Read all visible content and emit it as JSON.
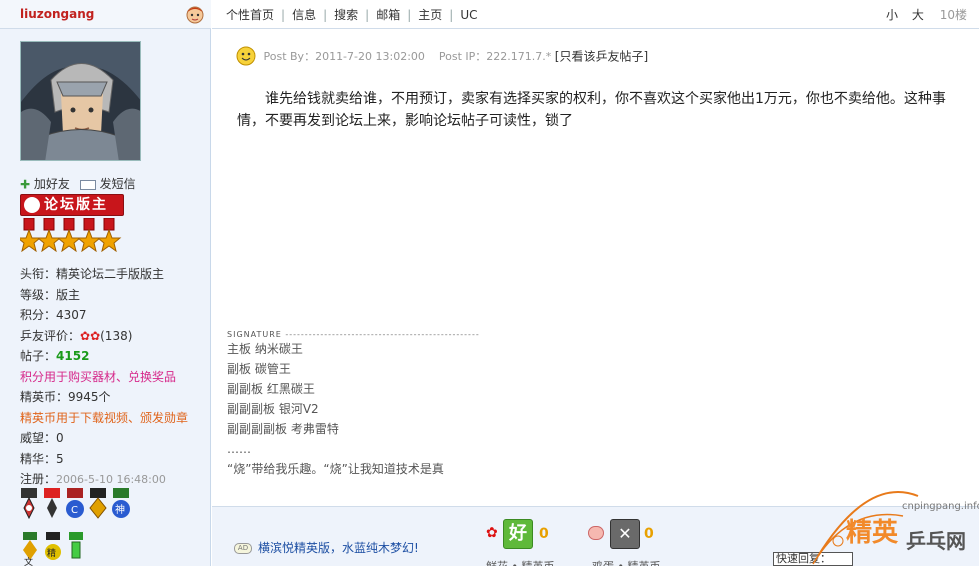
{
  "user": {
    "name": "liuzongang",
    "add_friend": "加好友",
    "send_message": "发短信",
    "badge": "论坛版主",
    "stats": [
      {
        "label": "头衔：",
        "value": "精英论坛二手版版主",
        "style": "normal"
      },
      {
        "label": "等级：",
        "value": "版主",
        "style": "normal"
      },
      {
        "label": "积分：",
        "value": "4307",
        "style": "normal"
      },
      {
        "label": "乒友评价：",
        "value": "(138)",
        "style": "normal"
      },
      {
        "label": "帖子：",
        "value": "4152",
        "style": "green"
      },
      {
        "label": "",
        "value": "积分用于购买器材、兑换奖品",
        "style": "pink"
      },
      {
        "label": "精英币：",
        "value": "9945个",
        "style": "normal"
      },
      {
        "label": "",
        "value": "精英币用于下载视频、颁发勋章",
        "style": "orange"
      },
      {
        "label": "威望：",
        "value": "0",
        "style": "normal"
      },
      {
        "label": "精华：",
        "value": "5",
        "style": "normal"
      },
      {
        "label": "注册：",
        "value": "2006-5-10 16:48:00",
        "style": "gray"
      }
    ],
    "medal_text": {
      "m5": "神",
      "m6": "文",
      "m7": "精"
    }
  },
  "nav": {
    "links": [
      "个性首页",
      "信息",
      "搜索",
      "邮箱",
      "主页",
      "UC"
    ],
    "font_small": "小",
    "font_large": "大",
    "floor": "10楼"
  },
  "post": {
    "meta": "Post By：2011-7-20 13:02:00    Post IP：222.171.7.*",
    "only_author": "[只看该乒友帖子]",
    "body": "谁先给钱就卖给谁，不用预订，卖家有选择买家的权利，你不喜欢这个买家他出1万元，你也不卖给他。这种事情，不要再发到论坛上来，影响论坛帖子可读性，锁了"
  },
  "signature": {
    "label": "SIGNATURE",
    "dashes": "--------------------------------------------------",
    "lines": [
      "主板  纳米碳王",
      "副板  碳管王",
      "副副板  红黑碳王",
      "副副副板  银河V2",
      "副副副副板  考弗雷特",
      "……",
      "“烧”带给我乐趣。“烧”让我知道技术是真"
    ]
  },
  "footer": {
    "ad_tag": "AD",
    "ad_text": "横滨悦精英版，水蓝纯木梦幻!",
    "good_label": "好",
    "good_count": "0",
    "bad_count": "0",
    "good_sub": "鲜花 • 精英币",
    "bad_sub": "鸡蛋 • 精英币",
    "quick_reply": "快速回复：",
    "watermark_cn1": "精英",
    "watermark_cn2": "乒乓网",
    "watermark_url": "cnpingpang.info"
  },
  "colors": {
    "accent_red": "#c1221f",
    "link_blue": "#1d4fa3",
    "pink": "#d6288a",
    "orange": "#e0641b",
    "green": "#1a9a1a"
  }
}
